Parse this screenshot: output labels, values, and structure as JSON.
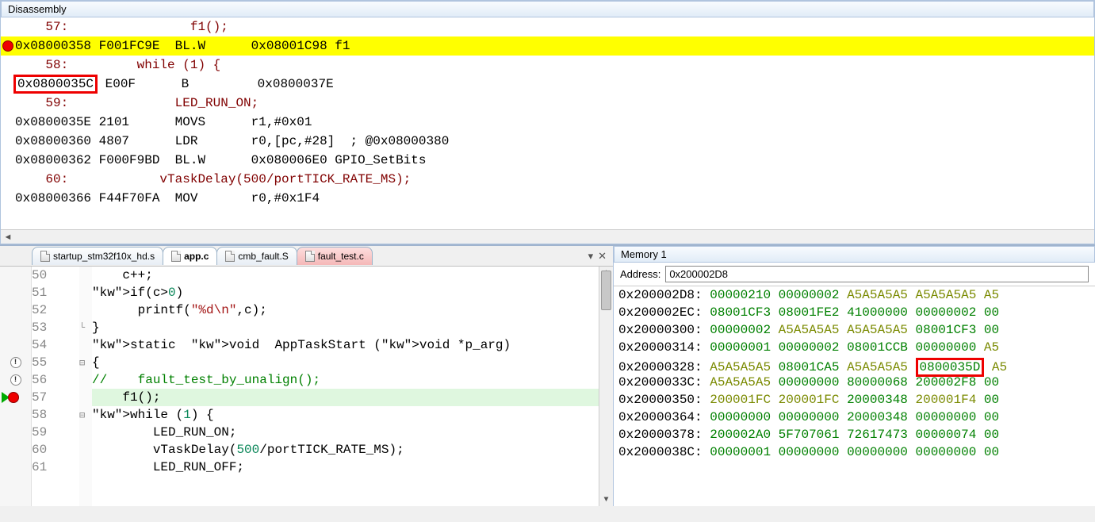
{
  "disassembly": {
    "title": "Disassembly",
    "lines": [
      {
        "type": "src",
        "lineno": "57",
        "text": "              f1();"
      },
      {
        "type": "asm",
        "bp": true,
        "hl": true,
        "addr": "0x08000358",
        "bytes": "F001FC9E",
        "mnemonic": "BL.W",
        "ops": "0x08001C98 f1"
      },
      {
        "type": "src",
        "lineno": "58",
        "text": "       while (1) {",
        "boxaddr": true
      },
      {
        "type": "asm",
        "addr": "0x0800035C",
        "bytes": "E00F",
        "mnemonic": "B",
        "ops": "0x0800037E",
        "boxAddrOnly": true
      },
      {
        "type": "src",
        "lineno": "59",
        "text": "            LED_RUN_ON;"
      },
      {
        "type": "asm",
        "addr": "0x0800035E",
        "bytes": "2101",
        "mnemonic": "MOVS",
        "ops": "r1,#0x01"
      },
      {
        "type": "asm",
        "addr": "0x08000360",
        "bytes": "4807",
        "mnemonic": "LDR",
        "ops": "r0,[pc,#28]  ; @0x08000380"
      },
      {
        "type": "asm",
        "addr": "0x08000362",
        "bytes": "F000F9BD",
        "mnemonic": "BL.W",
        "ops": "0x080006E0 GPIO_SetBits"
      },
      {
        "type": "src",
        "lineno": "60",
        "text": "          vTaskDelay(500/portTICK_RATE_MS);"
      },
      {
        "type": "asm",
        "addr": "0x08000366",
        "bytes": "F44F70FA",
        "mnemonic": "MOV",
        "ops": "r0,#0x1F4"
      }
    ]
  },
  "tabs": [
    {
      "label": "startup_stm32f10x_hd.s",
      "active": false,
      "red": false
    },
    {
      "label": "app.c",
      "active": true,
      "red": false
    },
    {
      "label": "cmb_fault.S",
      "active": false,
      "red": false
    },
    {
      "label": "fault_test.c",
      "active": false,
      "red": true
    }
  ],
  "source": {
    "lines": [
      {
        "n": "50",
        "m": "",
        "fold": "",
        "code": "    c++;"
      },
      {
        "n": "51",
        "m": "",
        "fold": "",
        "code": "    if(c>0)"
      },
      {
        "n": "52",
        "m": "",
        "fold": "",
        "code": "      printf(\"%d\\n\",c);"
      },
      {
        "n": "53",
        "m": "",
        "fold": "└",
        "code": "}"
      },
      {
        "n": "54",
        "m": "",
        "fold": "",
        "code": "static  void  AppTaskStart (void *p_arg)"
      },
      {
        "n": "55",
        "m": "warn",
        "fold": "⊟",
        "code": "{"
      },
      {
        "n": "56",
        "m": "warn",
        "fold": "",
        "code": "//    fault_test_by_unalign();",
        "cmt": true
      },
      {
        "n": "57",
        "m": "run",
        "fold": "",
        "code": "    f1();",
        "current": true
      },
      {
        "n": "58",
        "m": "",
        "fold": "⊟",
        "code": "    while (1) {"
      },
      {
        "n": "59",
        "m": "",
        "fold": "",
        "code": "        LED_RUN_ON;"
      },
      {
        "n": "60",
        "m": "",
        "fold": "",
        "code": "        vTaskDelay(500/portTICK_RATE_MS);"
      },
      {
        "n": "61",
        "m": "",
        "fold": "",
        "code": "        LED_RUN_OFF;"
      }
    ]
  },
  "memory": {
    "title": "Memory 1",
    "addressLabel": "Address:",
    "addressValue": "0x200002D8",
    "rows": [
      {
        "addr": "0x200002D8:",
        "vals": [
          "00000210",
          "00000002",
          "A5A5A5A5",
          "A5A5A5A5",
          "A5"
        ],
        "colors": [
          "g",
          "g",
          "y",
          "y",
          "y"
        ]
      },
      {
        "addr": "0x200002EC:",
        "vals": [
          "08001CF3",
          "08001FE2",
          "41000000",
          "00000002",
          "00"
        ],
        "colors": [
          "g",
          "g",
          "g",
          "g",
          "g"
        ]
      },
      {
        "addr": "0x20000300:",
        "vals": [
          "00000002",
          "A5A5A5A5",
          "A5A5A5A5",
          "08001CF3",
          "00"
        ],
        "colors": [
          "g",
          "y",
          "y",
          "g",
          "g"
        ]
      },
      {
        "addr": "0x20000314:",
        "vals": [
          "00000001",
          "00000002",
          "08001CCB",
          "00000000",
          "A5"
        ],
        "colors": [
          "g",
          "g",
          "g",
          "g",
          "y"
        ]
      },
      {
        "addr": "0x20000328:",
        "vals": [
          "A5A5A5A5",
          "08001CA5",
          "A5A5A5A5",
          "0800035D",
          "A5"
        ],
        "colors": [
          "y",
          "g",
          "y",
          "box",
          "y"
        ]
      },
      {
        "addr": "0x2000033C:",
        "vals": [
          "A5A5A5A5",
          "00000000",
          "80000068",
          "200002F8",
          "00"
        ],
        "colors": [
          "y",
          "g",
          "g",
          "g",
          "g"
        ]
      },
      {
        "addr": "0x20000350:",
        "vals": [
          "200001FC",
          "200001FC",
          "20000348",
          "200001F4",
          "00"
        ],
        "colors": [
          "y",
          "y",
          "g",
          "y",
          "g"
        ]
      },
      {
        "addr": "0x20000364:",
        "vals": [
          "00000000",
          "00000000",
          "20000348",
          "00000000",
          "00"
        ],
        "colors": [
          "g",
          "g",
          "g",
          "g",
          "g"
        ]
      },
      {
        "addr": "0x20000378:",
        "vals": [
          "200002A0",
          "5F707061",
          "72617473",
          "00000074",
          "00"
        ],
        "colors": [
          "g",
          "g",
          "g",
          "g",
          "g"
        ]
      },
      {
        "addr": "0x2000038C:",
        "vals": [
          "00000001",
          "00000000",
          "00000000",
          "00000000",
          "00"
        ],
        "colors": [
          "g",
          "g",
          "g",
          "g",
          "g"
        ]
      }
    ]
  }
}
